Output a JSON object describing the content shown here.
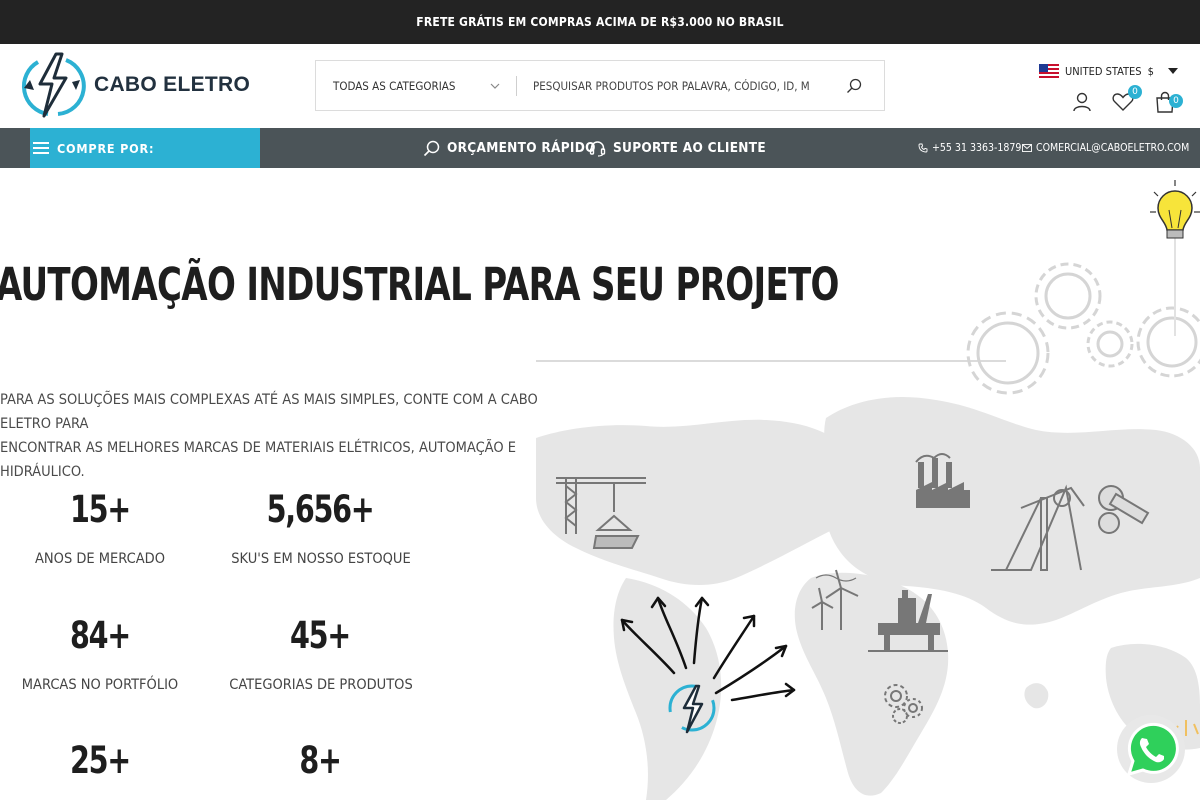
{
  "announcement": "FRETE GRÁTIS EM COMPRAS ACIMA DE R$3.000 NO BRASIL",
  "brand": {
    "name": "CABO ELETRO",
    "colors": {
      "accent": "#2cb1d3",
      "dark": "#22313f",
      "nav": "#4b5458",
      "topbar": "#232323"
    }
  },
  "search": {
    "category_label": "TODAS AS CATEGORIAS",
    "placeholder": "PESQUISAR PRODUTOS POR PALAVRA, CÓDIGO, ID, MARCA OU PAR"
  },
  "locale": {
    "country": "UNITED STATES",
    "currency": "$"
  },
  "header_icons": {
    "wishlist_count": "0",
    "cart_count": "0"
  },
  "nav": {
    "shop_by": "COMPRE POR:",
    "quick_quote": "ORÇAMENTO RÁPIDO",
    "support": "SUPORTE AO CLIENTE",
    "phone": "+55 31 3363-1879",
    "email": "COMERCIAL@CABOELETRO.COM"
  },
  "hero": {
    "title": "AUTOMAÇÃO INDUSTRIAL PARA SEU PROJETO",
    "subtitle_line1": "PARA AS SOLUÇÕES MAIS COMPLEXAS ATÉ AS MAIS SIMPLES, CONTE COM A CABO ELETRO PARA",
    "subtitle_line2": "ENCONTRAR AS MELHORES MARCAS DE MATERIAIS  ELÉTRICOS, AUTOMAÇÃO E HIDRÁULICO."
  },
  "stats": [
    {
      "value": "15+",
      "label": "ANOS DE MERCADO"
    },
    {
      "value": "5,656+",
      "label": "SKU'S EM NOSSO ESTOQUE"
    },
    {
      "value": "84+",
      "label": "MARCAS NO PORTFÓLIO"
    },
    {
      "value": "45+",
      "label": "CATEGORIAS DE PRODUTOS"
    },
    {
      "value": "25+",
      "label": ""
    },
    {
      "value": "8+",
      "label": ""
    }
  ],
  "icons": {
    "search": "search-icon",
    "user": "user-icon",
    "wishlist": "heart-icon",
    "cart": "bag-icon",
    "menu": "hamburger-icon",
    "quote": "search-icon",
    "support": "headset-icon",
    "phone": "phone-icon",
    "email": "envelope-icon",
    "whatsapp": "whatsapp-icon"
  }
}
